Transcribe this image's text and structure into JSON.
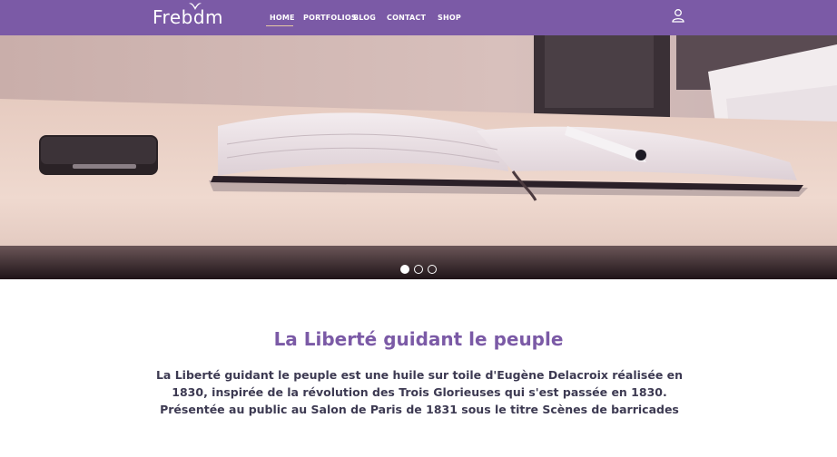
{
  "colors": {
    "brand": "#7b5aa6",
    "text": "#3d3a52",
    "nav_text": "#ffffff"
  },
  "navbar": {
    "logo": "Frebdm",
    "items": [
      {
        "label": "HOME",
        "active": true
      },
      {
        "label": "PORTFOLIOS",
        "active": false
      },
      {
        "label": "BLOG",
        "active": false
      },
      {
        "label": "CONTACT",
        "active": false
      },
      {
        "label": "SHOP",
        "active": false
      }
    ],
    "icons": {
      "user": "user-icon",
      "logo_bird": "bird-icon"
    }
  },
  "hero": {
    "slides_total": 3,
    "active_slide": 1
  },
  "content": {
    "title": "La Liberté guidant le peuple",
    "body": "La Liberté guidant  le peuple est une huile sur toile d'Eugène Delacroix réalisée en 1830, inspirée de la révolution des Trois Glorieuses qui s'est passée en 1830. Présentée au public au Salon de Paris de 1831 sous le titre Scènes de barricades"
  }
}
